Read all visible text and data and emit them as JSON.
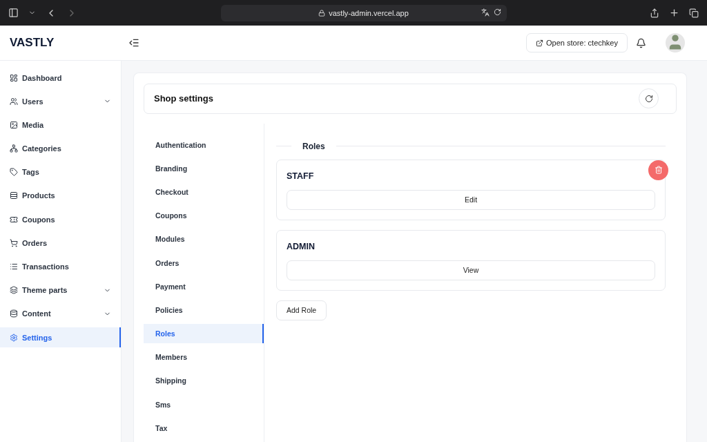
{
  "browser": {
    "url": "vastly-admin.vercel.app"
  },
  "brand": "VASTLY",
  "header": {
    "open_store": "Open store: ctechkey"
  },
  "sidebar": {
    "items": [
      {
        "label": "Dashboard",
        "expandable": false,
        "selected": false
      },
      {
        "label": "Users",
        "expandable": true,
        "selected": false
      },
      {
        "label": "Media",
        "expandable": false,
        "selected": false
      },
      {
        "label": "Categories",
        "expandable": false,
        "selected": false
      },
      {
        "label": "Tags",
        "expandable": false,
        "selected": false
      },
      {
        "label": "Products",
        "expandable": false,
        "selected": false
      },
      {
        "label": "Coupons",
        "expandable": false,
        "selected": false
      },
      {
        "label": "Orders",
        "expandable": false,
        "selected": false
      },
      {
        "label": "Transactions",
        "expandable": false,
        "selected": false
      },
      {
        "label": "Theme parts",
        "expandable": true,
        "selected": false
      },
      {
        "label": "Content",
        "expandable": true,
        "selected": false
      },
      {
        "label": "Settings",
        "expandable": false,
        "selected": true
      }
    ]
  },
  "page_title": "Shop settings",
  "settings_nav": [
    {
      "label": "Authentication",
      "selected": false
    },
    {
      "label": "Branding",
      "selected": false
    },
    {
      "label": "Checkout",
      "selected": false
    },
    {
      "label": "Coupons",
      "selected": false
    },
    {
      "label": "Modules",
      "selected": false
    },
    {
      "label": "Orders",
      "selected": false
    },
    {
      "label": "Payment",
      "selected": false
    },
    {
      "label": "Policies",
      "selected": false
    },
    {
      "label": "Roles",
      "selected": true
    },
    {
      "label": "Members",
      "selected": false
    },
    {
      "label": "Shipping",
      "selected": false
    },
    {
      "label": "Sms",
      "selected": false
    },
    {
      "label": "Tax",
      "selected": false
    }
  ],
  "section_title": "Roles",
  "roles": [
    {
      "name": "STAFF",
      "action": "Edit",
      "deletable": true
    },
    {
      "name": "ADMIN",
      "action": "View",
      "deletable": false
    }
  ],
  "add_role": "Add Role"
}
